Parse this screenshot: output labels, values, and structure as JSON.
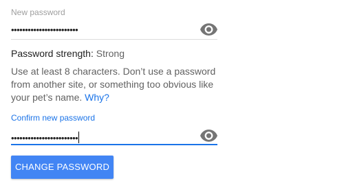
{
  "new_password": {
    "label": "New password",
    "value": "••••••••••••••••••••••••",
    "toggle_icon": "eye-icon"
  },
  "strength": {
    "label": "Password strength:",
    "value": "Strong"
  },
  "help": {
    "text": "Use at least 8 characters. Don’t use a password from another site, or something too obvious like your pet’s name.",
    "link": "Why?"
  },
  "confirm_password": {
    "label": "Confirm new password",
    "value": "••••••••••••••••••••••••",
    "toggle_icon": "eye-icon"
  },
  "submit": {
    "label": "CHANGE PASSWORD"
  },
  "colors": {
    "accent": "#1a73e8",
    "button": "#4285f4",
    "icon": "#757575"
  }
}
